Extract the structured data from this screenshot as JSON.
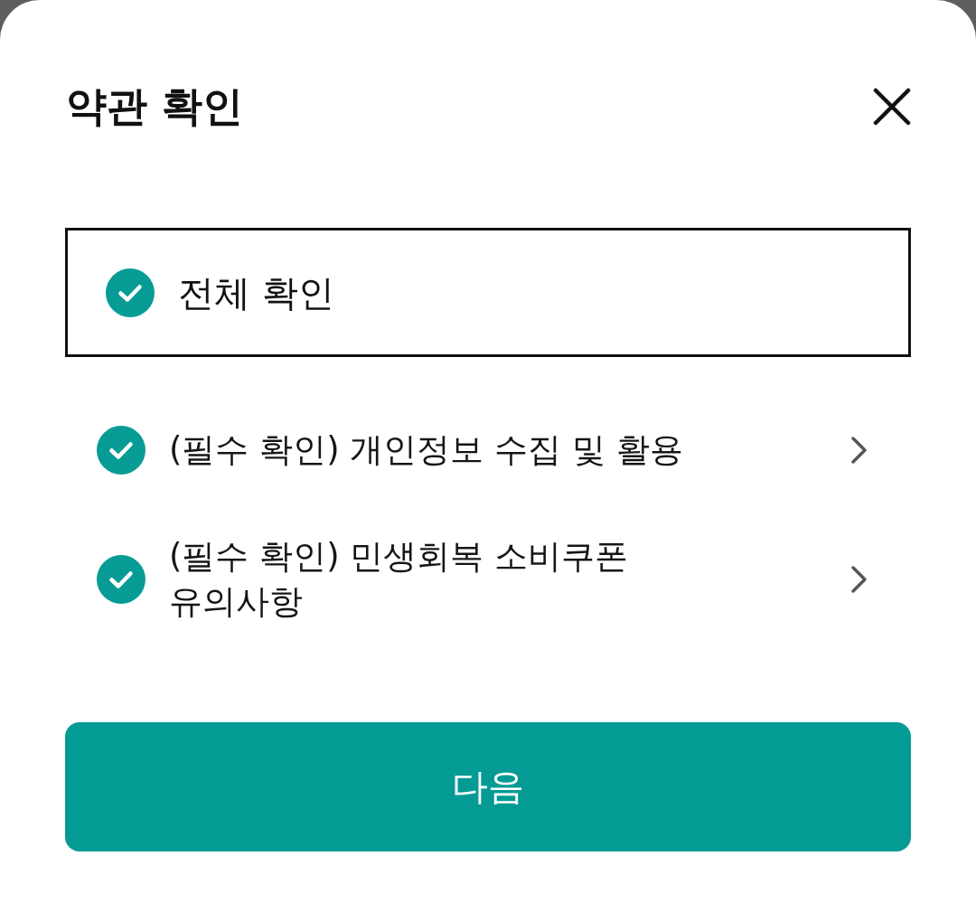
{
  "title": "약관 확인",
  "all_agree": {
    "label": "전체 확인",
    "checked": true
  },
  "terms": [
    {
      "label": "(필수 확인) 개인정보 수집 및 활용",
      "checked": true
    },
    {
      "label": "(필수 확인) 민생회복 소비쿠폰 유의사항",
      "checked": true
    }
  ],
  "next_button": {
    "label": "다음"
  }
}
